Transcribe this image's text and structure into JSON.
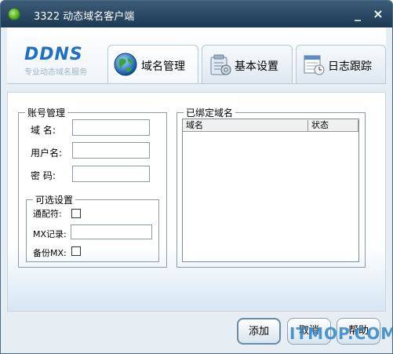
{
  "window": {
    "title": "3322 动态域名客户端",
    "minimize": "_",
    "close": "×"
  },
  "brand": {
    "logo": "DDNS",
    "tagline": "专业动态域名服务"
  },
  "tabs": [
    {
      "label": "域名管理",
      "icon": "globe-icon",
      "active": true
    },
    {
      "label": "基本设置",
      "icon": "settings-icon",
      "active": false
    },
    {
      "label": "日志跟踪",
      "icon": "log-icon",
      "active": false
    }
  ],
  "account": {
    "legend": "账号管理",
    "domain_label": "域  名:",
    "domain_value": "",
    "user_label": "用户名:",
    "user_value": "",
    "password_label": "密  码:",
    "password_value": ""
  },
  "optional": {
    "legend": "可选设置",
    "wildcard_label": "通配符:",
    "wildcard_checked": false,
    "mx_label": "MX记录:",
    "mx_value": "",
    "backup_mx_label": "备份MX:",
    "backup_mx_checked": false
  },
  "bound": {
    "legend": "已绑定域名",
    "columns": [
      "域名",
      "状态"
    ],
    "rows": []
  },
  "buttons": {
    "add": "添加",
    "cancel": "取消",
    "help": "帮助"
  },
  "watermark": "ITMOP.COM",
  "colors": {
    "titlebar": "#1d3a55",
    "accent": "#1f6fc3",
    "background": "#e6eef4"
  }
}
